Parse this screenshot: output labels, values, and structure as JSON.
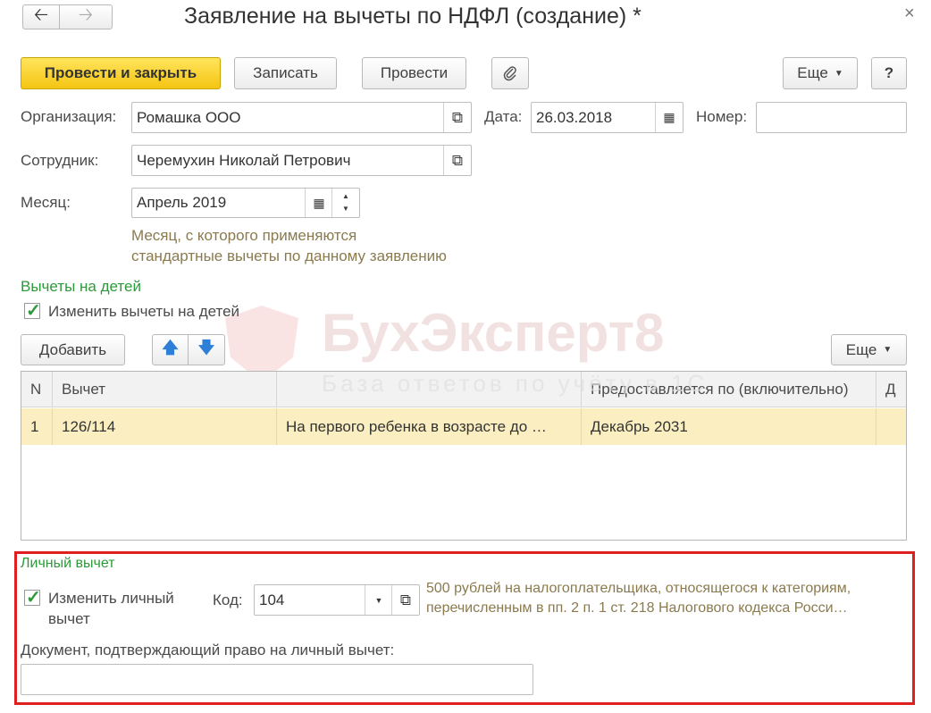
{
  "title": "Заявление на вычеты по НДФЛ (создание) *",
  "toolbar": {
    "post_close": "Провести и закрыть",
    "save": "Записать",
    "post": "Провести",
    "more": "Еще",
    "help": "?"
  },
  "form": {
    "org_label": "Организация:",
    "org_value": "Ромашка ООО",
    "date_label": "Дата:",
    "date_value": "26.03.2018",
    "number_label": "Номер:",
    "number_value": "",
    "employee_label": "Сотрудник:",
    "employee_value": "Черемухин Николай Петрович",
    "month_label": "Месяц:",
    "month_value": "Апрель 2019",
    "month_note_1": "Месяц, с которого применяются",
    "month_note_2": "стандартные вычеты по данному заявлению"
  },
  "children": {
    "section": "Вычеты на детей",
    "change_label": "Изменить вычеты на детей",
    "add": "Добавить",
    "more": "Еще",
    "columns": [
      "N",
      "Вычет",
      "",
      "Предоставляется по (включительно)",
      "Д"
    ],
    "rows": [
      {
        "n": "1",
        "code": "126/114",
        "desc": "На первого ребенка в возрасте до …",
        "until": "Декабрь 2031",
        "d": ""
      }
    ]
  },
  "personal": {
    "section": "Личный вычет",
    "change_label_1": "Изменить личный",
    "change_label_2": "вычет",
    "code_label": "Код:",
    "code_value": "104",
    "desc_1": "500 рублей на налогоплательщика, относящегося к категориям,",
    "desc_2": "перечисленным в пп. 2 п. 1 ст. 218 Налогового кодекса Росси…",
    "doc_label": "Документ, подтверждающий право на личный вычет:",
    "doc_value": ""
  },
  "watermark": {
    "title": "БухЭксперт8",
    "subtitle": "База ответов по учёту в 1С"
  },
  "colors": {
    "primary_button": "#f4c512",
    "section_green": "#2d9a3a",
    "highlight_border": "#e02020",
    "selected_row": "#fbeec0"
  }
}
